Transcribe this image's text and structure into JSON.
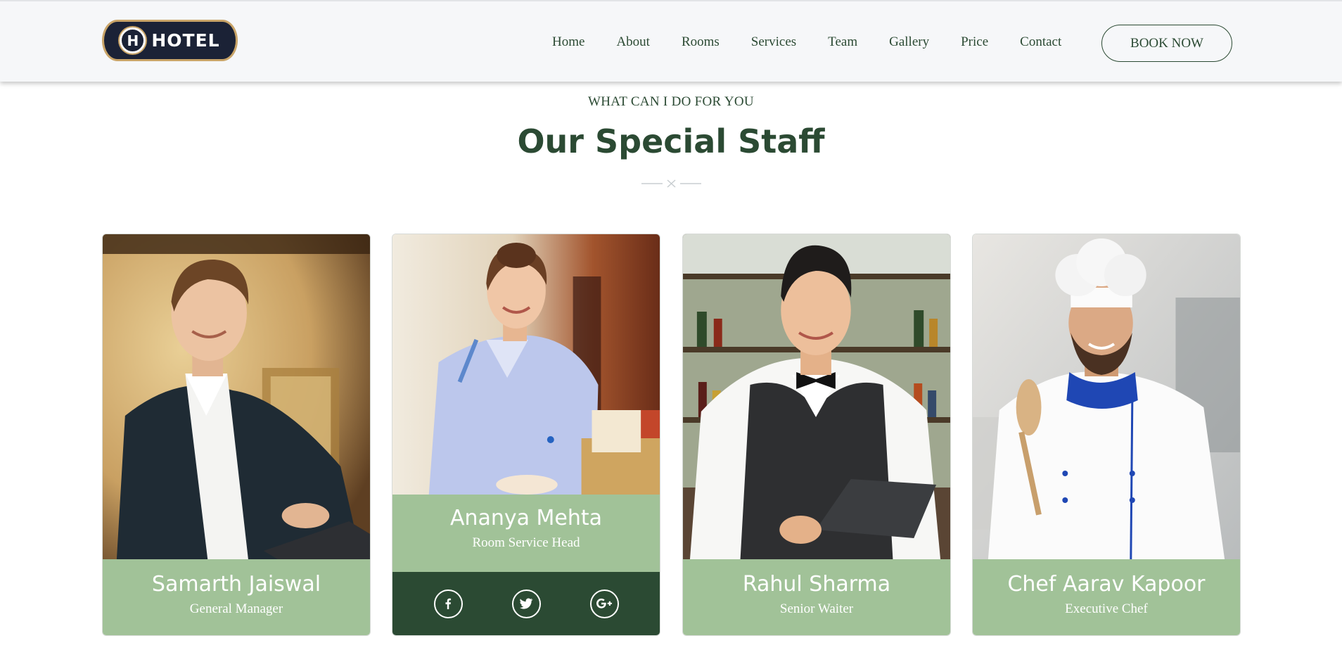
{
  "header": {
    "logo_text": "HOTEL",
    "logo_emblem": "H",
    "nav": [
      "Home",
      "About",
      "Rooms",
      "Services",
      "Team",
      "Gallery",
      "Price",
      "Contact"
    ],
    "cta_label": "BOOK NOW"
  },
  "section": {
    "eyebrow": "WHAT CAN I DO FOR YOU",
    "title": "Our Special Staff"
  },
  "staff": [
    {
      "name": "Samarth Jaiswal",
      "role": "General Manager"
    },
    {
      "name": "Ananya Mehta",
      "role": "Room Service Head"
    },
    {
      "name": "Rahul Sharma",
      "role": "Senior Waiter"
    },
    {
      "name": "Chef Aarav Kapoor",
      "role": "Executive Chef"
    }
  ],
  "social_icons": [
    "facebook-icon",
    "twitter-icon",
    "google-plus-icon"
  ],
  "colors": {
    "primary": "#2b4a33",
    "card_info_bg": "#a1c298",
    "header_bg": "#f6f7f9",
    "logo_bg": "#1b2236",
    "logo_border": "#c9a468"
  }
}
